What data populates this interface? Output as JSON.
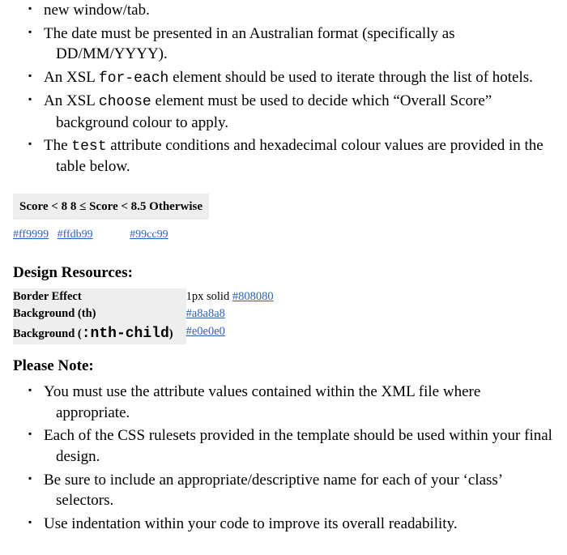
{
  "bullets_top": [
    {
      "pre": "",
      "code": "",
      "post": "new window/tab."
    },
    {
      "pre": "The date must be presented in an Australian format (specifically as DD/MM/YYYY).",
      "code": "",
      "post": ""
    },
    {
      "pre": "An XSL ",
      "code": "for-each",
      "post": " element should be used to iterate through the list of hotels."
    },
    {
      "pre": "An XSL ",
      "code": "choose",
      "post": " element must be used to decide which “Overall Score” background colour to apply."
    },
    {
      "pre": "The ",
      "code": "test",
      "post": " attribute conditions and hexadecimal colour values are provided in the table below."
    }
  ],
  "score_header": "Score < 8 8 ≤ Score < 8.5 Otherwise",
  "score_colors": {
    "c1": "#ff9999",
    "c2": "#ffdb99",
    "c3": "#99cc99"
  },
  "design_heading": "Design Resources:",
  "design_rows": [
    {
      "label": "Border Effect",
      "code": "",
      "value_text": "1px solid ",
      "value_link": "#808080"
    },
    {
      "label": "Background (th)",
      "code": "",
      "value_text": "",
      "value_link": "#a8a8a8"
    },
    {
      "label": "Background (",
      "code": ":nth-child",
      "label_after": ")",
      "value_text": "",
      "value_link": "#e0e0e0"
    }
  ],
  "note_heading": "Please Note:",
  "bullets_note": [
    "You must use the attribute values contained within the XML file where appropriate.",
    "Each of the CSS rulesets provided in the template should be used within your final design.",
    "Be sure to include an appropriate/descriptive name for each of your ‘class’ selectors.",
    "Use indentation within your code to improve its overall readability."
  ]
}
